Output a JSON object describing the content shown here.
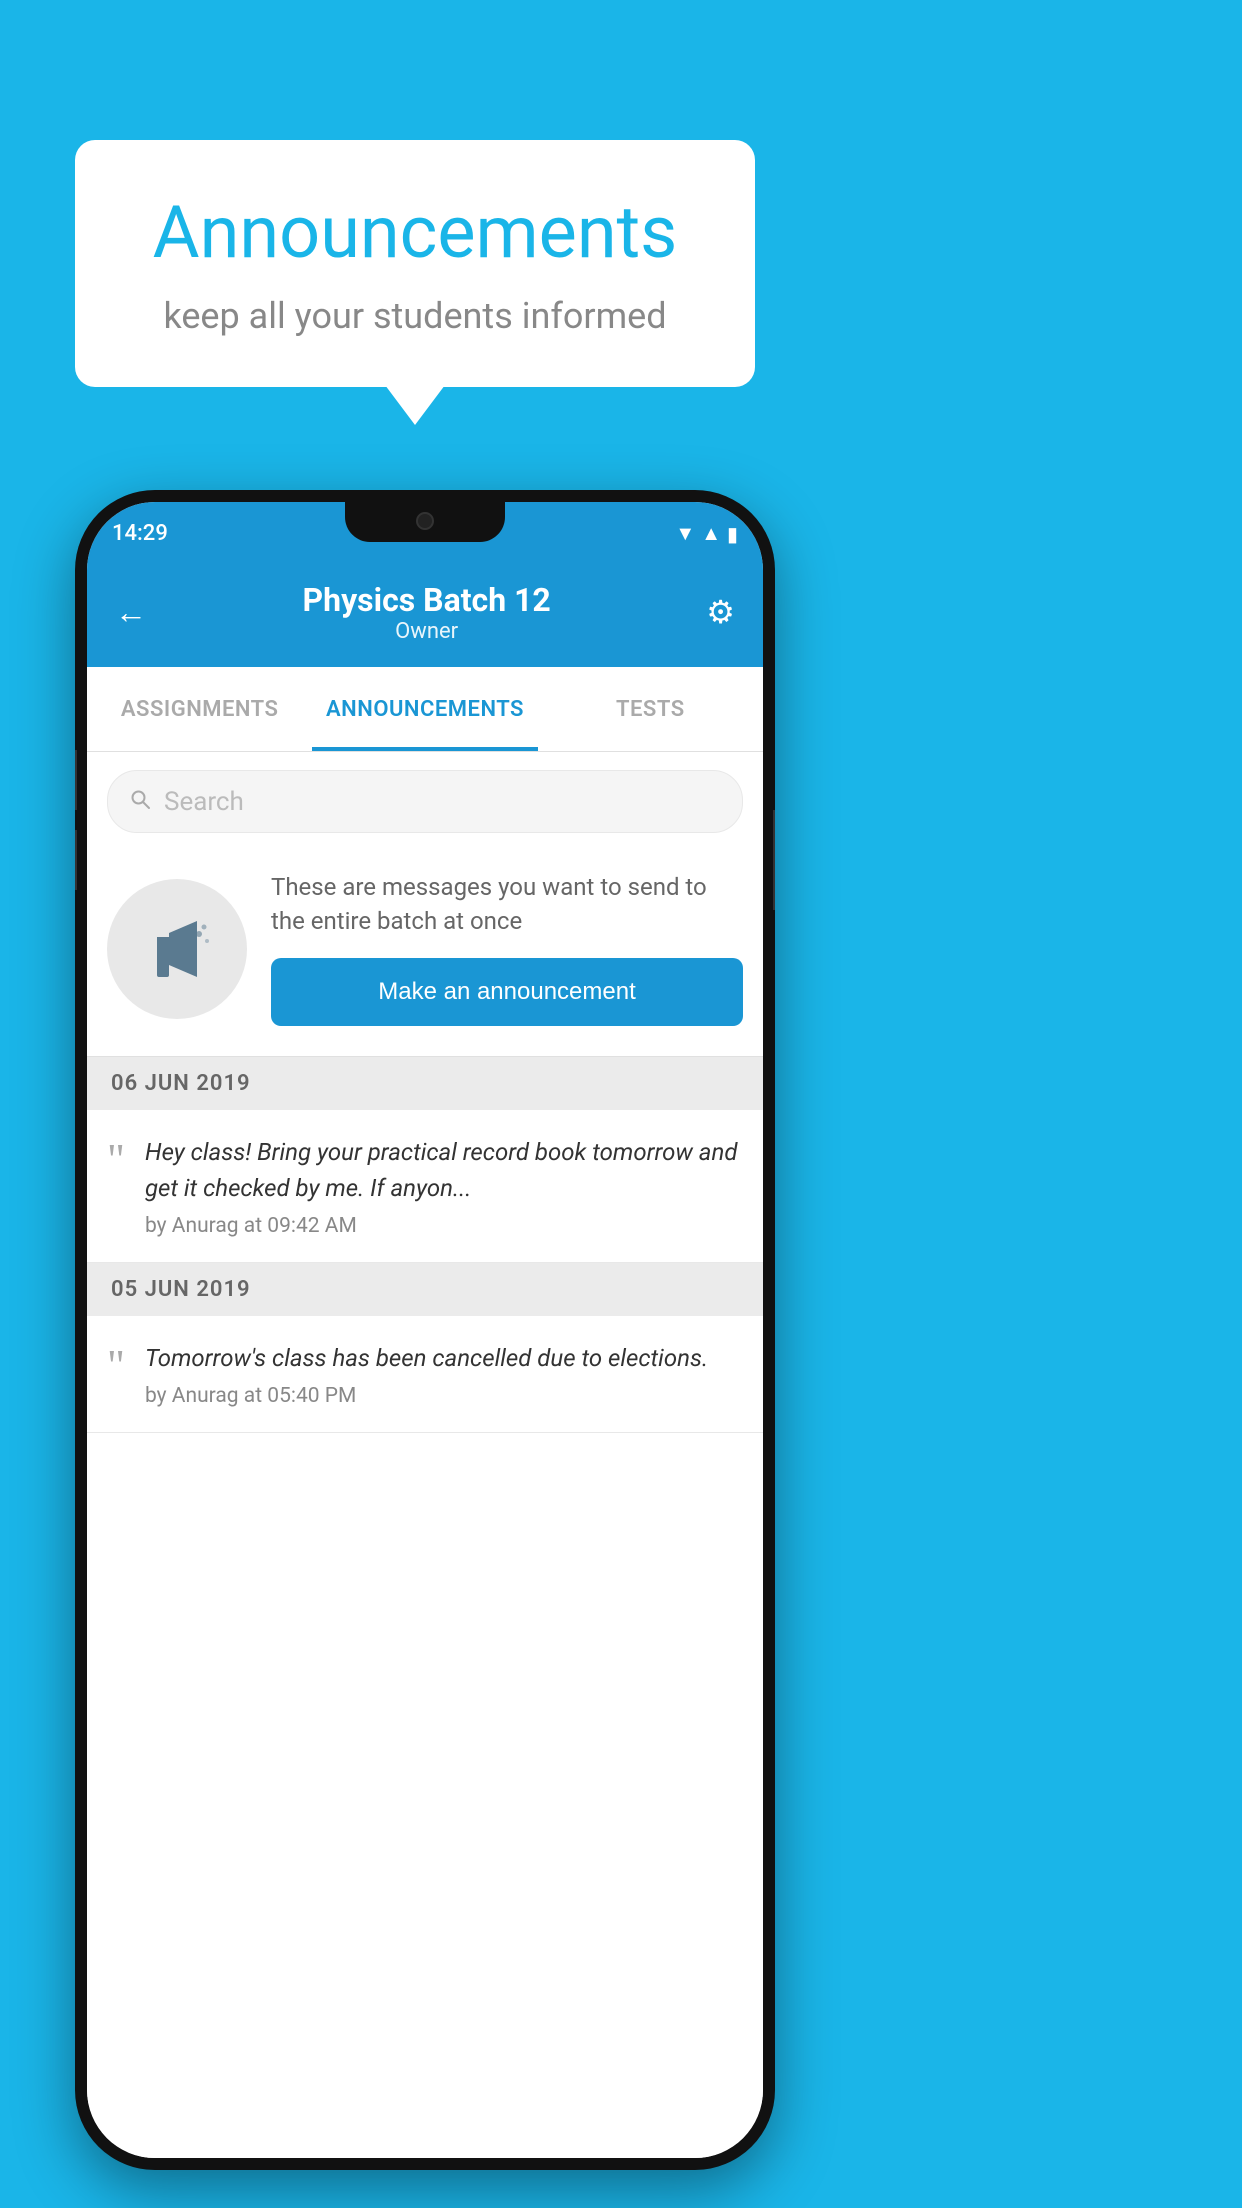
{
  "background_color": "#1ab5e8",
  "speech_bubble": {
    "title": "Announcements",
    "subtitle": "keep all your students informed"
  },
  "status_bar": {
    "time": "14:29",
    "wifi_icon": "▼",
    "signal_icon": "▲",
    "battery_icon": "▮"
  },
  "header": {
    "back_label": "←",
    "title": "Physics Batch 12",
    "subtitle": "Owner",
    "gear_icon": "⚙"
  },
  "tabs": [
    {
      "label": "ASSIGNMENTS",
      "active": false
    },
    {
      "label": "ANNOUNCEMENTS",
      "active": true
    },
    {
      "label": "TESTS",
      "active": false
    }
  ],
  "search": {
    "placeholder": "Search"
  },
  "promo": {
    "description": "These are messages you want to send to the entire batch at once",
    "button_label": "Make an announcement"
  },
  "announcement_groups": [
    {
      "date": "06  JUN  2019",
      "items": [
        {
          "message": "Hey class! Bring your practical record book tomorrow and get it checked by me. If anyon...",
          "meta": "by Anurag at 09:42 AM"
        }
      ]
    },
    {
      "date": "05  JUN  2019",
      "items": [
        {
          "message": "Tomorrow's class has been cancelled due to elections.",
          "meta": "by Anurag at 05:40 PM"
        }
      ]
    }
  ]
}
